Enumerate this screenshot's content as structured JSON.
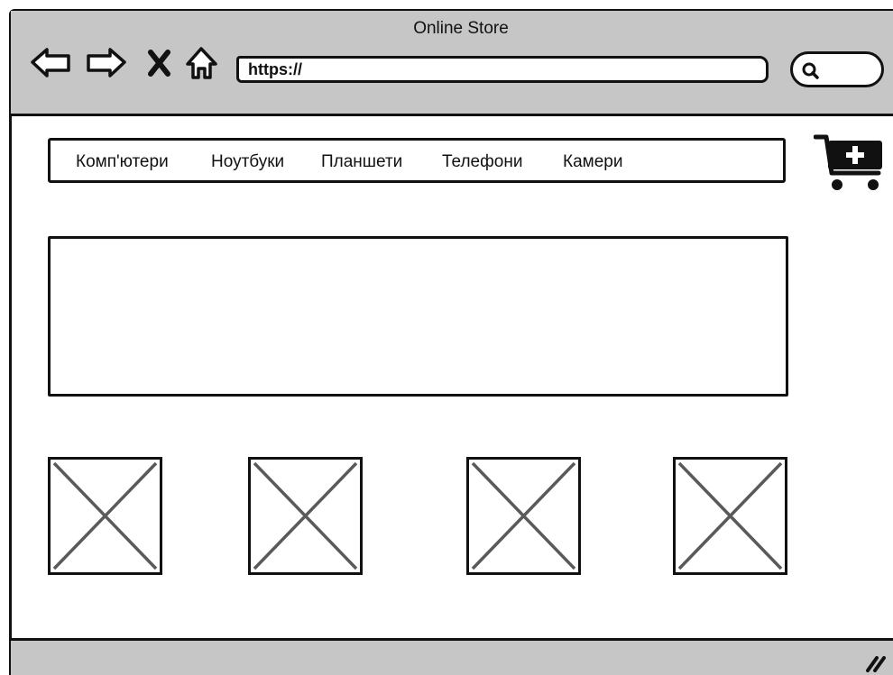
{
  "window": {
    "title": "Online Store"
  },
  "toolbar": {
    "back_icon": "back-arrow-icon",
    "forward_icon": "forward-arrow-icon",
    "stop_icon": "close-x-icon",
    "home_icon": "home-icon"
  },
  "address_bar": {
    "value": "https://"
  },
  "search": {
    "icon": "search-icon"
  },
  "menu": {
    "items": [
      {
        "label": "Комп'ютери"
      },
      {
        "label": "Ноутбуки"
      },
      {
        "label": "Планшети"
      },
      {
        "label": "Телефони"
      },
      {
        "label": "Камери"
      }
    ]
  },
  "cart": {
    "icon": "cart-add-icon"
  },
  "products": {
    "placeholders": [
      "image-placeholder",
      "image-placeholder",
      "image-placeholder",
      "image-placeholder"
    ]
  },
  "colors": {
    "chrome_gray": "#c6c6c6",
    "stroke": "#111111",
    "placeholder_cross": "#5a5a5a"
  }
}
